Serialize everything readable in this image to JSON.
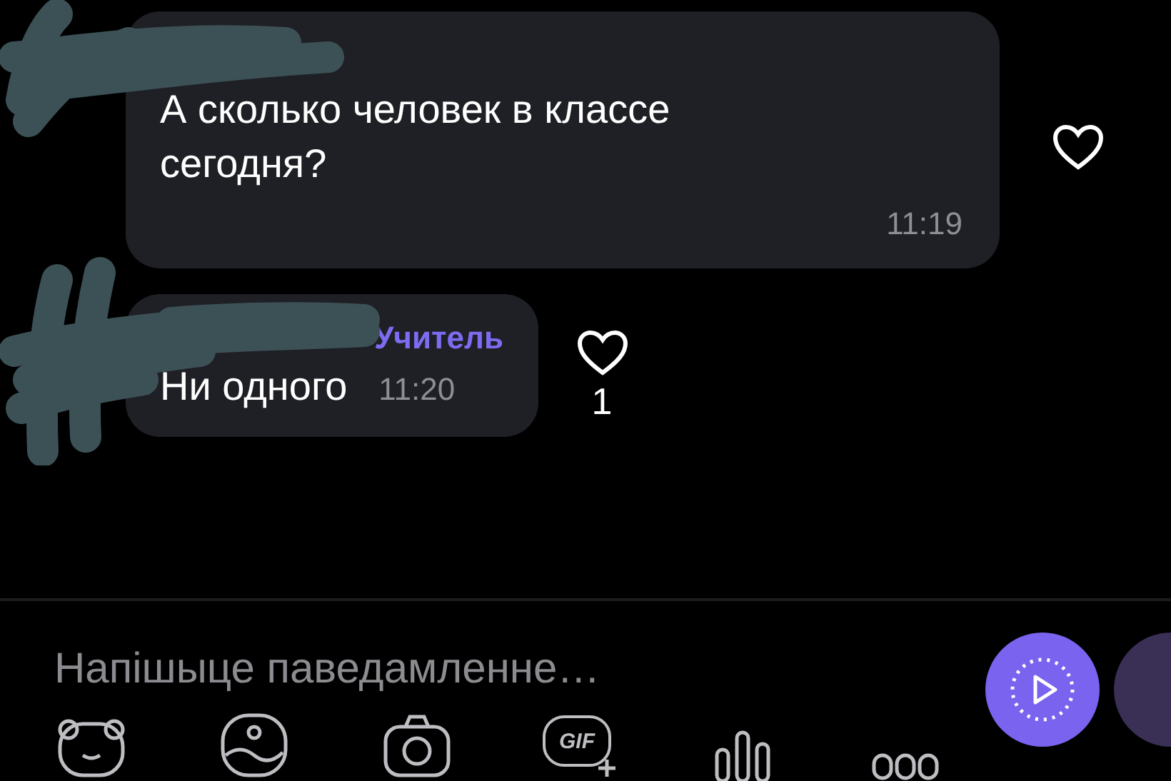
{
  "messages": [
    {
      "text": "А сколько человек в классе сегодня?",
      "time": "11:19"
    },
    {
      "sender_role": "Учитель",
      "text": "Ни одного",
      "time": "11:20",
      "likes": "1"
    }
  ],
  "composer": {
    "placeholder": "Напішыце паведамленне…",
    "gif_label": "GIF"
  }
}
